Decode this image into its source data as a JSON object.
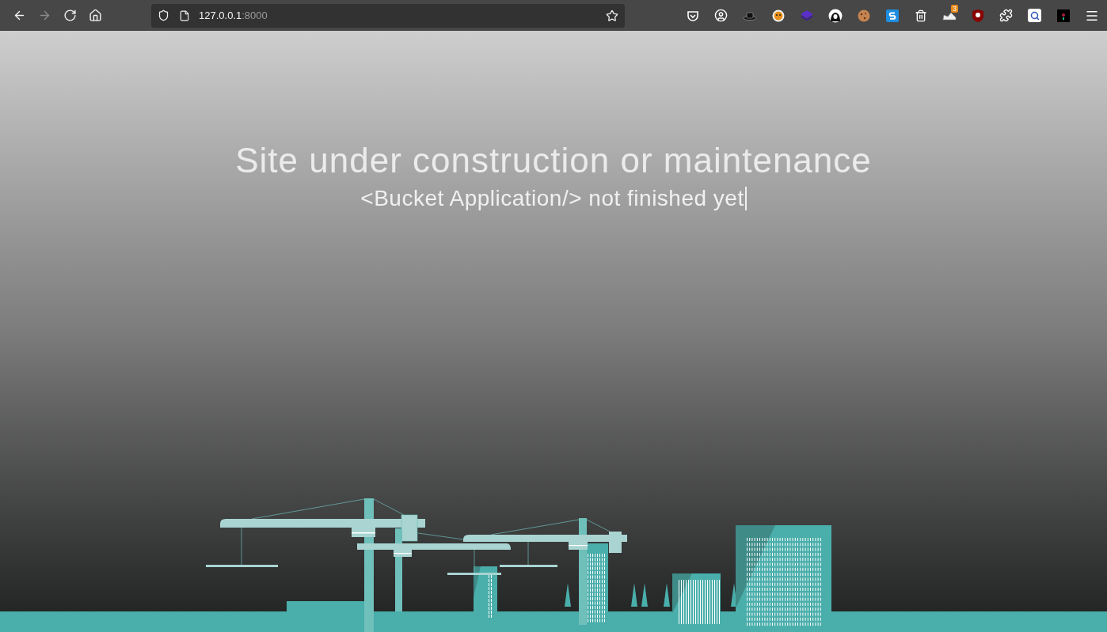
{
  "browser": {
    "nav_buttons": [
      {
        "kind": "back",
        "disabled": false
      },
      {
        "kind": "forward",
        "disabled": true
      },
      {
        "kind": "reload",
        "disabled": false
      },
      {
        "kind": "home",
        "disabled": false
      }
    ],
    "url": {
      "host": "127.0.0.1",
      "port": ":8000"
    },
    "toolbar_icons": [
      {
        "kind": "pocket"
      },
      {
        "kind": "account"
      },
      {
        "kind": "hat"
      },
      {
        "kind": "fox"
      },
      {
        "kind": "layers"
      },
      {
        "kind": "hood"
      },
      {
        "kind": "cookie"
      },
      {
        "kind": "s-logo"
      },
      {
        "kind": "trash"
      },
      {
        "kind": "shoe",
        "badge": "3"
      },
      {
        "kind": "shield"
      },
      {
        "kind": "puzzle"
      },
      {
        "kind": "search"
      },
      {
        "kind": "dark"
      },
      {
        "kind": "menu"
      }
    ]
  },
  "page": {
    "title": "Site under construction or maintenance",
    "subtitle": "<Bucket Application/> not finished yet",
    "cursor": true
  }
}
